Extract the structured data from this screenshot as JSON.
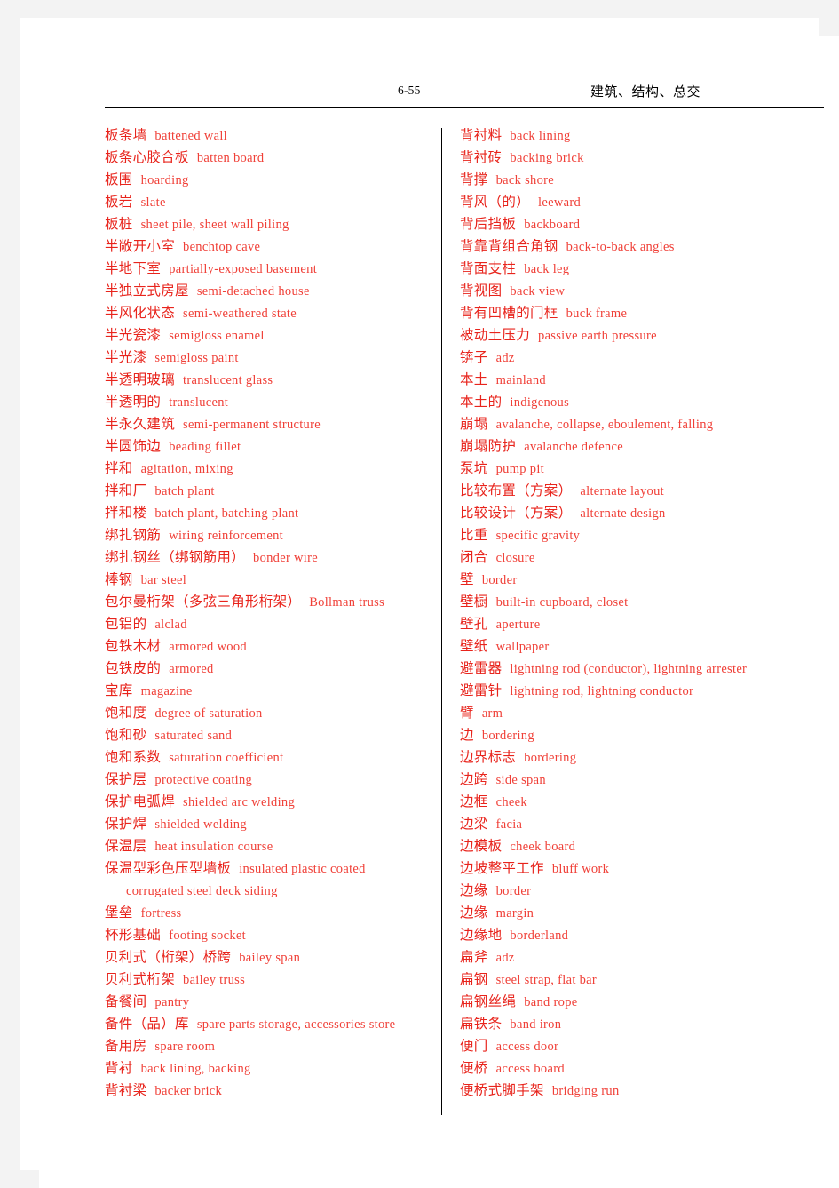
{
  "header": {
    "folio": "6-55",
    "running_head": "建筑、结构、总交"
  },
  "colors": {
    "term": "#e8241c",
    "gloss": "#f04038",
    "rule": "#000000",
    "page_background": "#ffffff",
    "margin_background": "#f3f3f3"
  },
  "columns": {
    "left": [
      {
        "cn": "板条墙",
        "en": "battened wall"
      },
      {
        "cn": "板条心胶合板",
        "en": "batten board"
      },
      {
        "cn": "板围",
        "en": "hoarding"
      },
      {
        "cn": "板岩",
        "en": "slate"
      },
      {
        "cn": "板桩",
        "en": "sheet pile, sheet wall piling"
      },
      {
        "cn": "半敞开小室",
        "en": "benchtop cave"
      },
      {
        "cn": "半地下室",
        "en": "partially-exposed basement"
      },
      {
        "cn": "半独立式房屋",
        "en": "semi-detached house"
      },
      {
        "cn": "半风化状态",
        "en": "semi-weathered state"
      },
      {
        "cn": "半光瓷漆",
        "en": "semigloss enamel"
      },
      {
        "cn": "半光漆",
        "en": "semigloss paint"
      },
      {
        "cn": "半透明玻璃",
        "en": "translucent glass"
      },
      {
        "cn": "半透明的",
        "en": "translucent"
      },
      {
        "cn": "半永久建筑",
        "en": "semi-permanent structure"
      },
      {
        "cn": "半圆饰边",
        "en": "beading fillet"
      },
      {
        "cn": "拌和",
        "en": "agitation, mixing"
      },
      {
        "cn": "拌和厂",
        "en": "batch plant"
      },
      {
        "cn": "拌和楼",
        "en": "batch plant, batching plant"
      },
      {
        "cn": "绑扎钢筋",
        "en": "wiring reinforcement"
      },
      {
        "cn": "绑扎钢丝（绑钢筋用）",
        "en": "bonder wire"
      },
      {
        "cn": "棒钢",
        "en": "bar steel"
      },
      {
        "cn": "包尔曼桁架（多弦三角形桁架）",
        "en": "Bollman truss"
      },
      {
        "cn": "包铝的",
        "en": "alclad"
      },
      {
        "cn": "包铁木材",
        "en": "armored wood"
      },
      {
        "cn": "包铁皮的",
        "en": "armored"
      },
      {
        "cn": "宝库",
        "en": "magazine"
      },
      {
        "cn": "饱和度",
        "en": "degree of saturation"
      },
      {
        "cn": "饱和砂",
        "en": "saturated sand"
      },
      {
        "cn": "饱和系数",
        "en": "saturation coefficient"
      },
      {
        "cn": "保护层",
        "en": "protective coating"
      },
      {
        "cn": "保护电弧焊",
        "en": "shielded arc welding"
      },
      {
        "cn": "保护焊",
        "en": "shielded welding"
      },
      {
        "cn": "保温层",
        "en": "heat insulation course"
      },
      {
        "cn": "保温型彩色压型墙板",
        "en": "insulated plastic coated"
      },
      {
        "cn": "",
        "en": "corrugated steel deck siding",
        "continuation": true
      },
      {
        "cn": "堡垒",
        "en": "fortress"
      },
      {
        "cn": "杯形基础",
        "en": "footing socket"
      },
      {
        "cn": "贝利式（桁架）桥跨",
        "en": "bailey span"
      },
      {
        "cn": "贝利式桁架",
        "en": "bailey truss"
      },
      {
        "cn": "备餐间",
        "en": "pantry"
      },
      {
        "cn": "备件（品）库",
        "en": "spare parts storage, accessories store"
      },
      {
        "cn": "备用房",
        "en": "spare room"
      },
      {
        "cn": "背衬",
        "en": "back lining, backing"
      },
      {
        "cn": "背衬梁",
        "en": "backer brick"
      }
    ],
    "right": [
      {
        "cn": "背衬料",
        "en": "back lining"
      },
      {
        "cn": "背衬砖",
        "en": "backing brick"
      },
      {
        "cn": "背撑",
        "en": "back shore"
      },
      {
        "cn": "背风（的）",
        "en": "leeward"
      },
      {
        "cn": "背后挡板",
        "en": "backboard"
      },
      {
        "cn": "背靠背组合角钢",
        "en": "back-to-back angles"
      },
      {
        "cn": "背面支柱",
        "en": "back leg"
      },
      {
        "cn": "背视图",
        "en": "back view"
      },
      {
        "cn": "背有凹槽的门框",
        "en": "buck frame"
      },
      {
        "cn": "被动土压力",
        "en": "passive earth pressure"
      },
      {
        "cn": "锛子",
        "en": "adz"
      },
      {
        "cn": "本土",
        "en": "mainland"
      },
      {
        "cn": "本土的",
        "en": "indigenous"
      },
      {
        "cn": "崩塌",
        "en": "avalanche, collapse, eboulement, falling"
      },
      {
        "cn": "崩塌防护",
        "en": "avalanche defence"
      },
      {
        "cn": "泵坑",
        "en": "pump pit"
      },
      {
        "cn": "比较布置（方案）",
        "en": "alternate layout"
      },
      {
        "cn": "比较设计（方案）",
        "en": "alternate design"
      },
      {
        "cn": "比重",
        "en": "specific gravity"
      },
      {
        "cn": "闭合",
        "en": "closure"
      },
      {
        "cn": "壁",
        "en": "border"
      },
      {
        "cn": "壁橱",
        "en": "built-in cupboard, closet"
      },
      {
        "cn": "壁孔",
        "en": "aperture"
      },
      {
        "cn": "壁纸",
        "en": "wallpaper"
      },
      {
        "cn": "避雷器",
        "en": "lightning rod (conductor), lightning arrester"
      },
      {
        "cn": "避雷针",
        "en": "lightning rod, lightning conductor"
      },
      {
        "cn": "臂",
        "en": "arm"
      },
      {
        "cn": "边",
        "en": "bordering"
      },
      {
        "cn": "边界标志",
        "en": "bordering"
      },
      {
        "cn": "边跨",
        "en": "side span"
      },
      {
        "cn": "边框",
        "en": "cheek"
      },
      {
        "cn": "边梁",
        "en": "facia"
      },
      {
        "cn": "边模板",
        "en": "cheek board"
      },
      {
        "cn": "边坡整平工作",
        "en": "bluff work"
      },
      {
        "cn": "边缘",
        "en": "border"
      },
      {
        "cn": "边缘",
        "en": "margin"
      },
      {
        "cn": "边缘地",
        "en": "borderland"
      },
      {
        "cn": "扁斧",
        "en": "adz"
      },
      {
        "cn": "扁钢",
        "en": "steel strap, flat bar"
      },
      {
        "cn": "扁钢丝绳",
        "en": "band rope"
      },
      {
        "cn": "扁铁条",
        "en": "band iron"
      },
      {
        "cn": "便门",
        "en": "access door"
      },
      {
        "cn": "便桥",
        "en": "access board"
      },
      {
        "cn": "便桥式脚手架",
        "en": "bridging run"
      }
    ]
  }
}
